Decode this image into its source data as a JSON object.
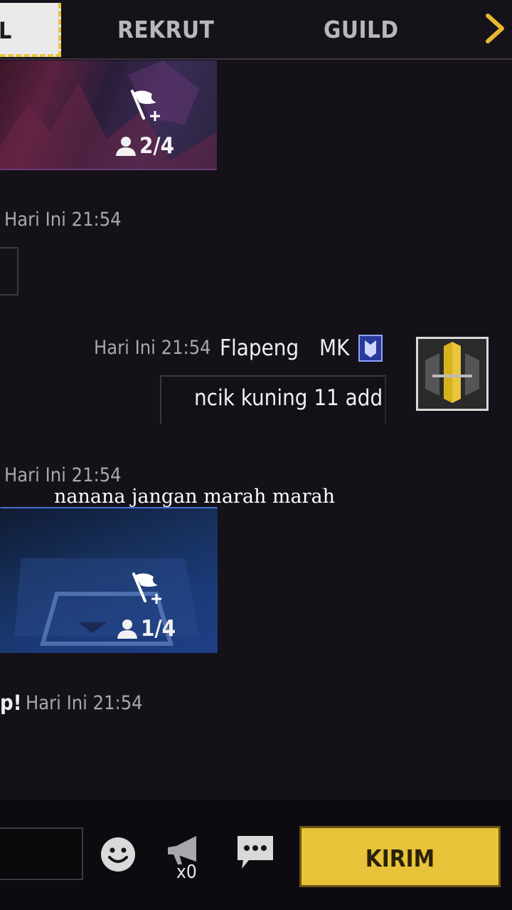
{
  "tabs": [
    {
      "label": "L",
      "active": true
    },
    {
      "label": "REKRUT",
      "active": false
    },
    {
      "label": "GUILD",
      "active": false
    }
  ],
  "cards": [
    {
      "slots": "2/4"
    },
    {
      "slots": "1/4"
    }
  ],
  "messages": [
    {
      "timestamp": "Hari Ini 21:54"
    },
    {
      "timestamp": "Hari Ini 21:54",
      "username": "Flapeng",
      "tag": "MK",
      "text": "ncik kuning 11 add"
    },
    {
      "timestamp": "Hari Ini 21:54"
    },
    {
      "prefix": "p!",
      "timestamp": "Hari Ini 21:54"
    }
  ],
  "overlay_caption": "nanana jangan marah marah",
  "bottom": {
    "megaphone_count": "x0",
    "send_label": "KIRIM"
  },
  "colors": {
    "accent": "#e7c33a",
    "background": "#141118"
  }
}
